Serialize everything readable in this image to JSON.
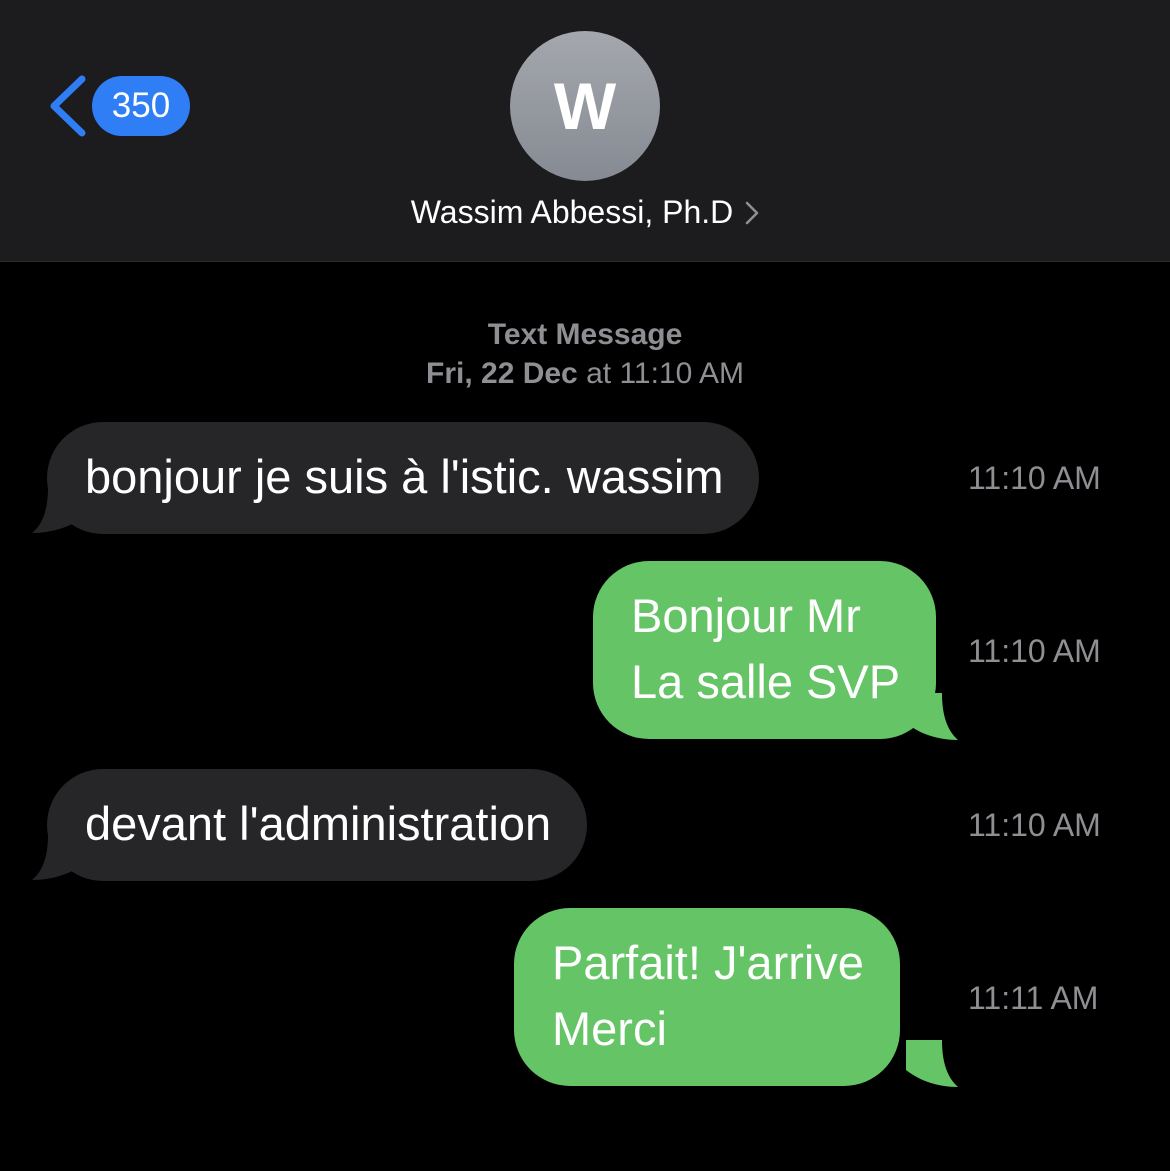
{
  "header": {
    "back_count": "350",
    "avatar_initial": "W",
    "contact_name": "Wassim Abbessi, Ph.D"
  },
  "conversation": {
    "service": "Text Message",
    "date_day": "Fri, 22 Dec",
    "date_at": "at",
    "date_time": "11:10 AM",
    "messages": [
      {
        "direction": "received",
        "lines": [
          "bonjour je suis à l'istic. wassim"
        ],
        "time": "11:10 AM"
      },
      {
        "direction": "sent",
        "lines": [
          "Bonjour Mr",
          "La salle SVP"
        ],
        "time": "11:10 AM"
      },
      {
        "direction": "received",
        "lines": [
          "devant l'administration"
        ],
        "time": "11:10 AM"
      },
      {
        "direction": "sent",
        "lines": [
          "Parfait! J'arrive",
          "Merci"
        ],
        "time": "11:11 AM"
      }
    ]
  },
  "colors": {
    "header_bg": "#1c1c1e",
    "accent_blue": "#2f7ef6",
    "sent_bubble": "#65c466",
    "received_bubble": "#262628",
    "secondary_text": "#8e8e93"
  },
  "icons": {
    "back": "chevron-left-icon",
    "contact_details": "chevron-right-icon"
  }
}
